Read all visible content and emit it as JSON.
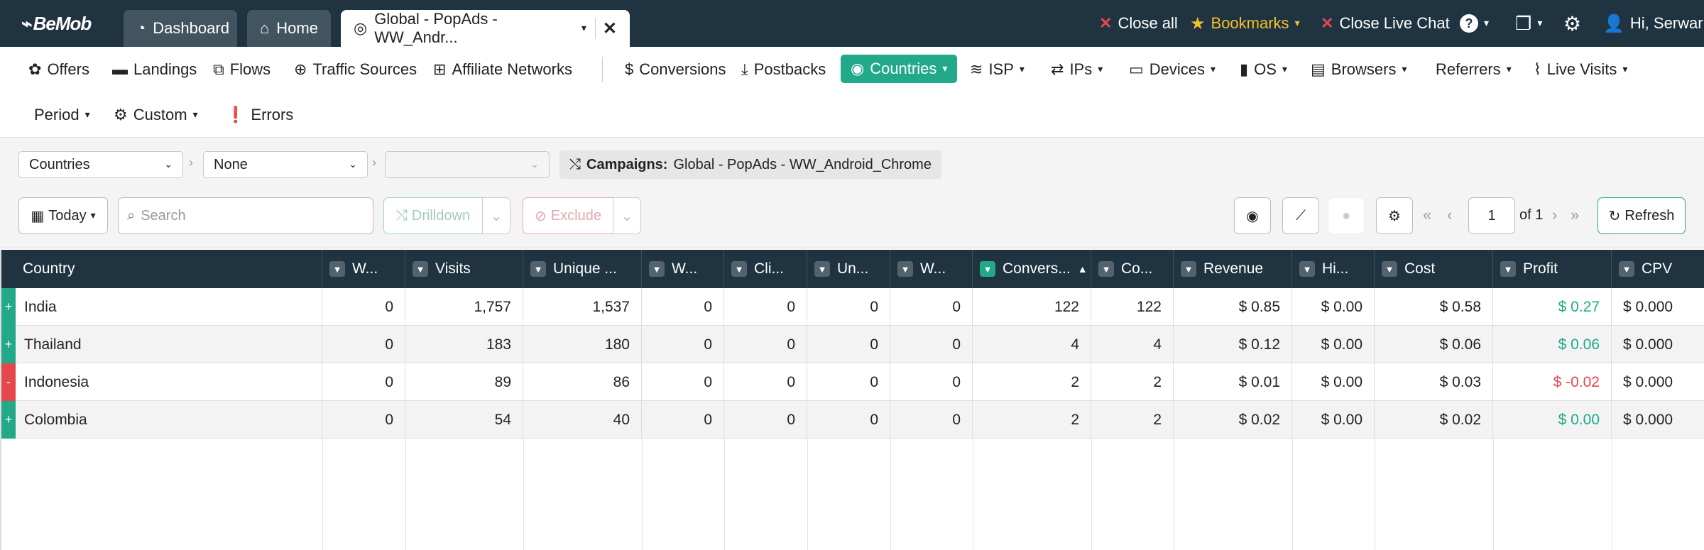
{
  "app": {
    "logo": "BeMob"
  },
  "tabs": [
    {
      "label": "Dashboard"
    },
    {
      "label": "Home"
    },
    {
      "label": "Global - PopAds - WW_Andr..."
    }
  ],
  "top_right": {
    "close_all": "Close all",
    "bookmarks": "Bookmarks",
    "close_chat": "Close Live Chat",
    "user": "Hi, Serwar"
  },
  "nav": {
    "offers": "Offers",
    "landings": "Landings",
    "flows": "Flows",
    "traffic_sources": "Traffic Sources",
    "affiliate_networks": "Affiliate Networks",
    "conversions": "Conversions",
    "postbacks": "Postbacks",
    "countries": "Countries",
    "isp": "ISP",
    "ips": "IPs",
    "devices": "Devices",
    "os": "OS",
    "browsers": "Browsers",
    "referrers": "Referrers",
    "live_visits": "Live Visits",
    "period": "Period",
    "custom": "Custom",
    "errors": "Errors"
  },
  "filters": {
    "group1": "Countries",
    "group2": "None",
    "group3": "",
    "campaign_label": "Campaigns:",
    "campaign_value": "Global - PopAds - WW_Android_Chrome",
    "date": "Today",
    "search_placeholder": "Search",
    "drilldown": "Drilldown",
    "exclude": "Exclude",
    "page": "1",
    "of_pages": "of 1",
    "refresh": "Refresh"
  },
  "table": {
    "columns": [
      "Country",
      "W...",
      "Visits",
      "Unique ...",
      "W...",
      "Cli...",
      "Un...",
      "W...",
      "Convers...",
      "Co...",
      "Revenue",
      "Hi...",
      "Cost",
      "Profit",
      "CPV"
    ],
    "rows": [
      {
        "expand": "+",
        "country": "India",
        "c1": "0",
        "visits": "1,757",
        "unique": "1,537",
        "c4": "0",
        "clicks": "0",
        "c6": "0",
        "c7": "0",
        "conv": "122",
        "co": "122",
        "revenue": "$ 0.85",
        "hi": "$ 0.00",
        "cost": "$ 0.58",
        "profit": "$ 0.27",
        "cpv": "$ 0.000"
      },
      {
        "expand": "+",
        "country": "Thailand",
        "c1": "0",
        "visits": "183",
        "unique": "180",
        "c4": "0",
        "clicks": "0",
        "c6": "0",
        "c7": "0",
        "conv": "4",
        "co": "4",
        "revenue": "$ 0.12",
        "hi": "$ 0.00",
        "cost": "$ 0.06",
        "profit": "$ 0.06",
        "cpv": "$ 0.000"
      },
      {
        "expand": "-",
        "country": "Indonesia",
        "c1": "0",
        "visits": "89",
        "unique": "86",
        "c4": "0",
        "clicks": "0",
        "c6": "0",
        "c7": "0",
        "conv": "2",
        "co": "2",
        "revenue": "$ 0.01",
        "hi": "$ 0.00",
        "cost": "$ 0.03",
        "profit": "$ -0.02",
        "cpv": "$ 0.000"
      },
      {
        "expand": "+",
        "country": "Colombia",
        "c1": "0",
        "visits": "54",
        "unique": "40",
        "c4": "0",
        "clicks": "0",
        "c6": "0",
        "c7": "0",
        "conv": "2",
        "co": "2",
        "revenue": "$ 0.02",
        "hi": "$ 0.00",
        "cost": "$ 0.02",
        "profit": "$ 0.00",
        "cpv": "$ 0.000"
      }
    ]
  },
  "colors": {
    "header_dark": "#1f3340",
    "accent_green": "#21a98a",
    "negative_red": "#e5474f",
    "star_gold": "#f2c029"
  }
}
